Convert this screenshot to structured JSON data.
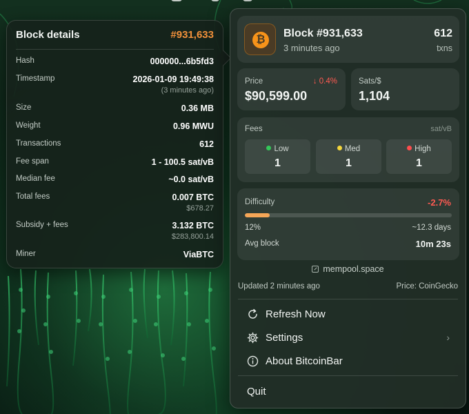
{
  "block_details": {
    "title": "Block details",
    "height": "#931,633",
    "rows": [
      {
        "label": "Hash",
        "value": "000000...6b5fd3",
        "sub": ""
      },
      {
        "label": "Timestamp",
        "value": "2026-01-09 19:49:38",
        "sub": "(3 minutes ago)"
      },
      {
        "label": "Size",
        "value": "0.36 MB",
        "sub": ""
      },
      {
        "label": "Weight",
        "value": "0.96 MWU",
        "sub": ""
      },
      {
        "label": "Transactions",
        "value": "612",
        "sub": ""
      },
      {
        "label": "Fee span",
        "value": "1 - 100.5 sat/vB",
        "sub": ""
      },
      {
        "label": "Median fee",
        "value": "~0.0 sat/vB",
        "sub": ""
      },
      {
        "label": "Total fees",
        "value": "0.007 BTC",
        "sub": "$678.27"
      },
      {
        "label": "Subsidy + fees",
        "value": "3.132 BTC",
        "sub": "$283,800.14"
      },
      {
        "label": "Miner",
        "value": "ViaBTC",
        "sub": ""
      }
    ]
  },
  "popover": {
    "header": {
      "logo_icon": "bitcoin-icon",
      "logo_glyph": "₿",
      "title": "Block #931,633",
      "subtitle": "3 minutes ago",
      "txn_count": "612",
      "txn_label": "txns"
    },
    "price": {
      "label": "Price",
      "change": "↓ 0.4%",
      "value": "$90,599.00"
    },
    "sats": {
      "label": "Sats/$",
      "value": "1,104"
    },
    "fees": {
      "label": "Fees",
      "unit": "sat/vB",
      "tiers": [
        {
          "name": "Low",
          "value": "1",
          "color": "#34c759"
        },
        {
          "name": "Med",
          "value": "1",
          "color": "#f5d63c"
        },
        {
          "name": "High",
          "value": "1",
          "color": "#ff4d4d"
        }
      ]
    },
    "difficulty": {
      "label": "Difficulty",
      "change": "-2.7%",
      "progress": 0.12,
      "progress_label": "12%",
      "eta": "~12.3 days",
      "avg_label": "Avg block",
      "avg_value": "10m 23s"
    },
    "mempool_link": "mempool.space",
    "updated": "Updated 2 minutes ago",
    "price_source": "Price: CoinGecko",
    "menu": {
      "refresh": "Refresh Now",
      "settings": "Settings",
      "about": "About BitcoinBar",
      "quit": "Quit"
    }
  },
  "colors": {
    "accent_orange": "#f2913b",
    "negative_red": "#ff5a52",
    "progress_orange": "#f5a657"
  }
}
